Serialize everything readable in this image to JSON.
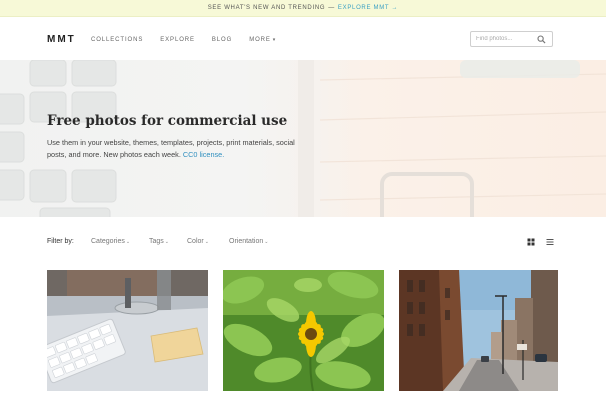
{
  "announcement": {
    "text": "SEE WHAT'S NEW AND TRENDING",
    "separator": "—",
    "link": "EXPLORE MMT →"
  },
  "header": {
    "logo": "MMT",
    "nav": [
      {
        "label": "COLLECTIONS"
      },
      {
        "label": "EXPLORE"
      },
      {
        "label": "BLOG"
      },
      {
        "label": "MORE",
        "caret": "▾"
      }
    ],
    "search": {
      "placeholder": "Find photos...",
      "icon": "search-icon"
    }
  },
  "hero": {
    "title": "Free photos for commercial use",
    "subtitle": "Use them in your website, themes, templates, projects, print materials, social posts, and more. New photos each week.",
    "license_link": "CC0 license."
  },
  "filters": {
    "label": "Filter by:",
    "items": [
      {
        "label": "Categories",
        "caret": "⌄"
      },
      {
        "label": "Tags",
        "caret": "⌄"
      },
      {
        "label": "Color",
        "caret": "⌄"
      },
      {
        "label": "Orientation",
        "caret": "⌄"
      }
    ],
    "view_grid_icon": "grid-view-icon",
    "view_list_icon": "list-view-icon"
  },
  "photos": [
    {
      "subject": "keyboard-desk-photo"
    },
    {
      "subject": "yellow-flower-photo"
    },
    {
      "subject": "city-street-photo"
    }
  ],
  "colors": {
    "announce_bg": "#f7f9d7",
    "link": "#3aa0c4",
    "text": "#333333"
  }
}
